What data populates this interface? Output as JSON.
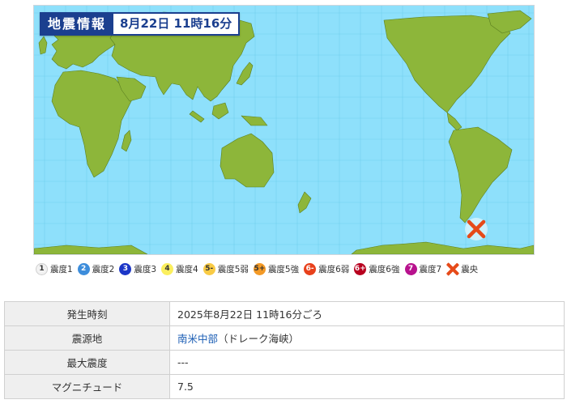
{
  "map": {
    "title": "地震情報",
    "date": "8月22日 11時16分",
    "colors": {
      "ocean": "#8ee0fb",
      "land": "#8db63a",
      "grid": "#6fcfee",
      "epicenter": "#e64a19"
    }
  },
  "legend": [
    {
      "badge": "1",
      "label": "震度1",
      "bg": "#f2f2f2",
      "fg": "#333333"
    },
    {
      "badge": "2",
      "label": "震度2",
      "bg": "#3d8ddb",
      "fg": "#ffffff"
    },
    {
      "badge": "3",
      "label": "震度3",
      "bg": "#1c36c7",
      "fg": "#ffffff"
    },
    {
      "badge": "4",
      "label": "震度4",
      "bg": "#fbef5e",
      "fg": "#333333"
    },
    {
      "badge": "5-",
      "label": "震度5弱",
      "bg": "#f9cb45",
      "fg": "#333333"
    },
    {
      "badge": "5+",
      "label": "震度5強",
      "bg": "#f39a27",
      "fg": "#333333"
    },
    {
      "badge": "6-",
      "label": "震度6弱",
      "bg": "#e8411c",
      "fg": "#ffffff"
    },
    {
      "badge": "6+",
      "label": "震度6強",
      "bg": "#b8001f",
      "fg": "#ffffff"
    },
    {
      "badge": "7",
      "label": "震度7",
      "bg": "#b8128e",
      "fg": "#ffffff"
    }
  ],
  "legend_epicenter": {
    "icon": "epicenter-cross-icon",
    "label": "震央"
  },
  "info": {
    "time_label": "発生時刻",
    "time_value": "2025年8月22日 11時16分ごろ",
    "place_label": "震源地",
    "place_link": "南米中部",
    "place_detail": "（ドレーク海峡）",
    "intensity_label": "最大震度",
    "intensity_value": "---",
    "magnitude_label": "マグニチュード",
    "magnitude_value": "7.5"
  }
}
